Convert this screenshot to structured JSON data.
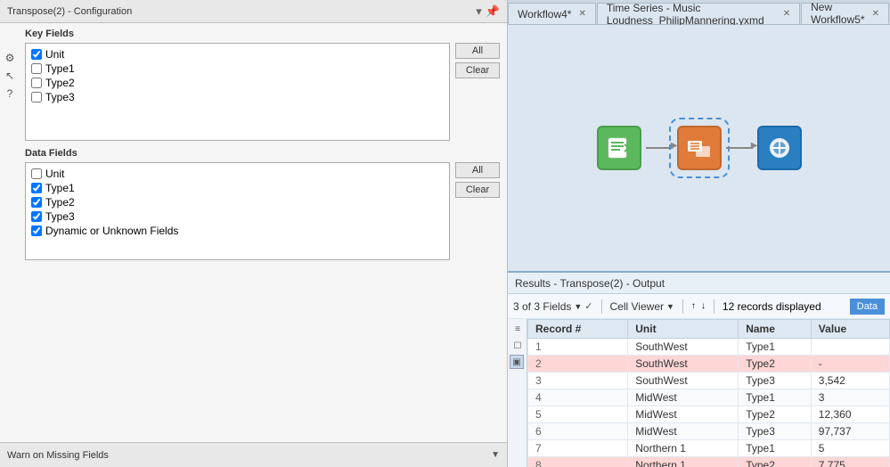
{
  "leftPanel": {
    "title": "Transpose(2) - Configuration",
    "keyFields": {
      "label": "Key Fields",
      "fields": [
        {
          "name": "Unit",
          "checked": true
        },
        {
          "name": "Type1",
          "checked": false
        },
        {
          "name": "Type2",
          "checked": false
        },
        {
          "name": "Type3",
          "checked": false
        }
      ],
      "allBtn": "All",
      "clearBtn": "Clear"
    },
    "dataFields": {
      "label": "Data Fields",
      "fields": [
        {
          "name": "Unit",
          "checked": false
        },
        {
          "name": "Type1",
          "checked": true
        },
        {
          "name": "Type2",
          "checked": true
        },
        {
          "name": "Type3",
          "checked": true
        },
        {
          "name": "Dynamic or Unknown Fields",
          "checked": true
        }
      ],
      "allBtn": "All",
      "clearBtn": "Clear"
    },
    "footer": {
      "text": "Warn on Missing Fields"
    }
  },
  "tabs": [
    {
      "label": "Workflow4*",
      "active": false,
      "closable": true
    },
    {
      "label": "Time Series - Music Loudness_PhilipMannering.yxmd",
      "active": false,
      "closable": true
    },
    {
      "label": "New Workflow5*",
      "active": true,
      "closable": true
    }
  ],
  "results": {
    "header": "Results - Transpose(2) - Output",
    "toolbar": {
      "fieldsText": "3 of 3 Fields",
      "viewerText": "Cell Viewer",
      "recordsText": "12 records displayed",
      "dataBtnLabel": "Data"
    },
    "columns": [
      "Record #",
      "Unit",
      "Name",
      "Value"
    ],
    "rows": [
      {
        "record": "1",
        "unit": "SouthWest",
        "name": "Type1",
        "value": "",
        "highlight": false
      },
      {
        "record": "2",
        "unit": "SouthWest",
        "name": "Type2",
        "value": "-",
        "highlight": true
      },
      {
        "record": "3",
        "unit": "SouthWest",
        "name": "Type3",
        "value": "3,542",
        "highlight": false
      },
      {
        "record": "4",
        "unit": "MidWest",
        "name": "Type1",
        "value": "3",
        "highlight": false
      },
      {
        "record": "5",
        "unit": "MidWest",
        "name": "Type2",
        "value": "12,360",
        "highlight": false
      },
      {
        "record": "6",
        "unit": "MidWest",
        "name": "Type3",
        "value": "97,737",
        "highlight": false
      },
      {
        "record": "7",
        "unit": "Northern 1",
        "name": "Type1",
        "value": "5",
        "highlight": false
      },
      {
        "record": "8",
        "unit": "Northern 1",
        "name": "Type2",
        "value": "7,775",
        "highlight": true
      }
    ]
  },
  "workflow": {
    "nodes": [
      {
        "id": "input",
        "icon": "📖",
        "colorClass": "node-green"
      },
      {
        "id": "transpose",
        "icon": "⊞",
        "colorClass": "node-orange"
      },
      {
        "id": "output",
        "icon": "⊕",
        "colorClass": "node-blue"
      }
    ]
  },
  "icons": {
    "gear": "⚙",
    "pointer": "↖",
    "pin": "📌",
    "minimize": "▾",
    "chevronDown": "▼",
    "sortUp": "↑",
    "sortDown": "↓",
    "checkAll": "☰",
    "select": "▣",
    "questionMark": "?"
  }
}
